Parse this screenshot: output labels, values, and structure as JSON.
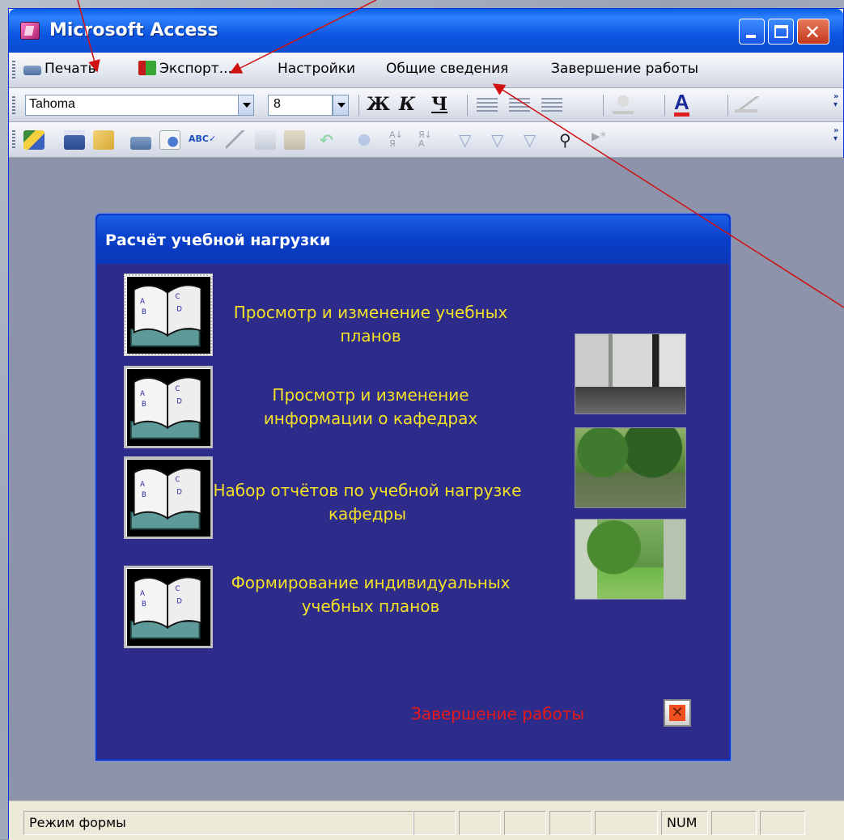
{
  "window": {
    "title": "Microsoft Access"
  },
  "menubar": {
    "items": [
      {
        "label": "Печать",
        "icon": "printer-icon"
      },
      {
        "label": "Экспорт...",
        "icon": "export-icon"
      },
      {
        "label": "Настройки"
      },
      {
        "label": "Общие сведения"
      },
      {
        "label": "Завершение работы"
      }
    ]
  },
  "format_toolbar": {
    "font_name": "Tahoma",
    "font_size": "8",
    "bold_label": "Ж",
    "italic_label": "К",
    "underline_label": "Ч",
    "font_color_label": "A"
  },
  "form": {
    "title": "Расчёт учебной нагрузки",
    "commands": [
      {
        "label": "Просмотр и изменение учебных планов",
        "icon": "book-icon"
      },
      {
        "label": "Просмотр и изменение информации о кафедрах",
        "icon": "book-icon"
      },
      {
        "label": "Набор отчётов по учебной нагрузке  кафедры",
        "icon": "book-icon"
      },
      {
        "label": "Формирование индивидуальных учебных планов",
        "icon": "book-icon"
      }
    ],
    "exit_label": "Завершение работы",
    "exit_icon": "close-icon"
  },
  "statusbar": {
    "mode": "Режим формы",
    "num": "NUM"
  },
  "colors": {
    "form_bg": "#2e2c8a",
    "label_yellow": "#f3e028",
    "exit_red": "#e81818",
    "arrow_red": "#d01010"
  }
}
